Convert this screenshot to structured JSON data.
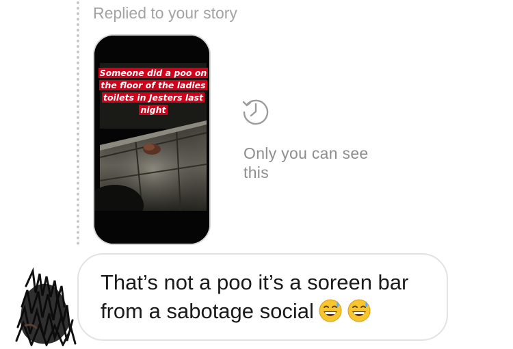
{
  "reply_header": {
    "label": "Replied to your story"
  },
  "story": {
    "caption_lines": [
      "Someone did a poo on",
      "the floor of the ladies",
      "toilets in Jesters last",
      "night"
    ]
  },
  "privacy_notice": {
    "icon": "history-icon",
    "text": "Only you can see this"
  },
  "message": {
    "text": "That’s not a poo it’s a soreen bar from a sabotage social",
    "emojis": [
      "grinning-sweat-emoji",
      "grinning-sweat-emoji"
    ]
  },
  "sender": {
    "avatar": "scribbled-avatar"
  },
  "colors": {
    "caption_highlight": "#d0021b",
    "muted_text": "#a3a3a3",
    "bubble_border": "#e2e2e2"
  }
}
